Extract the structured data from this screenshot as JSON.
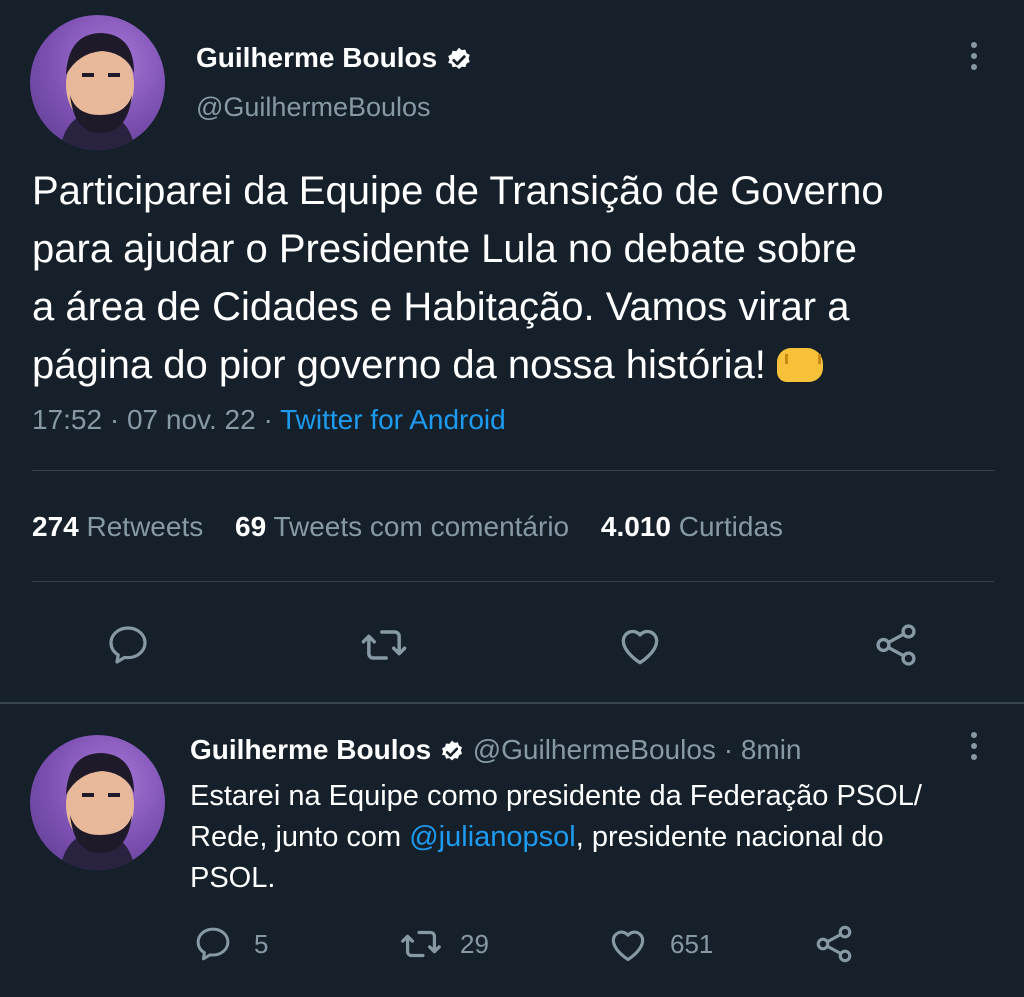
{
  "main_tweet": {
    "author_name": "Guilherme Boulos",
    "handle": "@GuilhermeBoulos",
    "avatar_icon": "user-avatar",
    "text_lines": [
      "Participarei da Equipe de Transição de Governo",
      "para ajudar o Presidente Lula no debate sobre",
      "a área de Cidades e Habitação. Vamos virar a",
      "página do pior governo da nossa história!"
    ],
    "emoji": "oncoming-fist-emoji",
    "time": "17:52",
    "sep": "·",
    "date": "07 nov. 22",
    "source": "Twitter for Android",
    "stats": {
      "retweets_count": "274",
      "retweets_label": "Retweets",
      "quotes_count": "69",
      "quotes_label": "Tweets com comentário",
      "likes_count": "4.010",
      "likes_label": "Curtidas"
    }
  },
  "reply_tweet": {
    "author_name": "Guilherme Boulos",
    "handle": "@GuilhermeBoulos",
    "sep": "·",
    "time_ago": "8min",
    "text_part1": "Estarei na Equipe como presidente da Federação PSOL/",
    "text_part2": "Rede, junto com ",
    "mention": "@julianopsol",
    "text_part3": ", presidente nacional do",
    "text_part4": "PSOL.",
    "reply_count": "5",
    "retweet_count": "29",
    "like_count": "651"
  },
  "colors": {
    "background": "#15202b",
    "muted": "#8899a6",
    "link": "#1d9bf0",
    "divider": "#38444d"
  }
}
